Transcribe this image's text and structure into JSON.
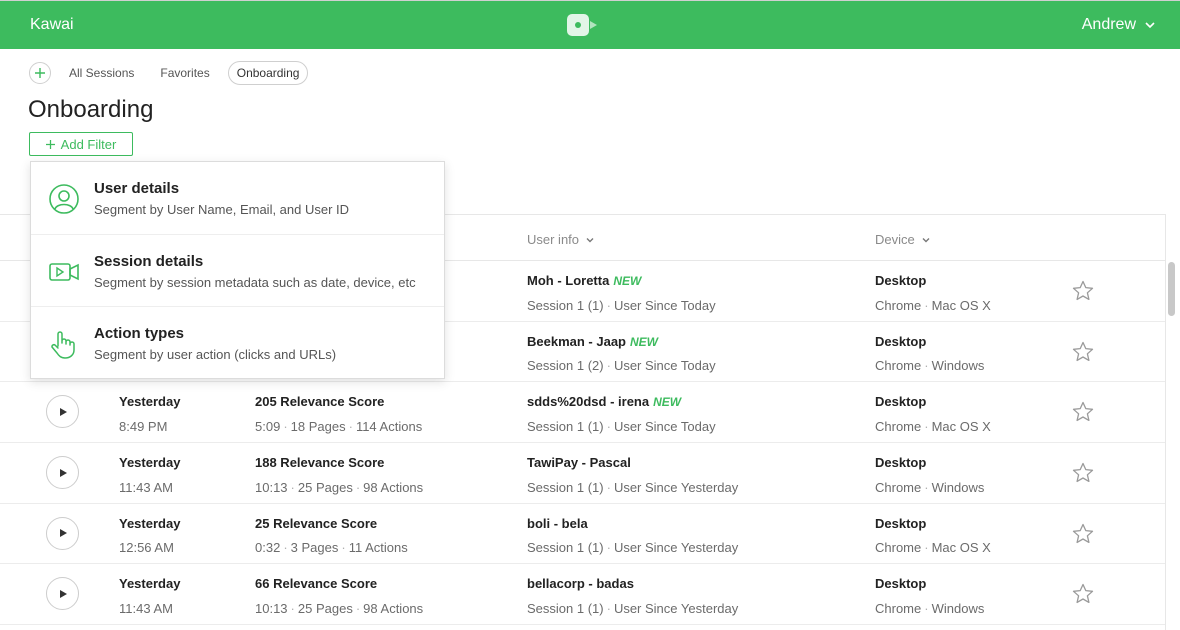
{
  "app": {
    "brand": "Kawai",
    "user": "Andrew"
  },
  "nav": {
    "tabs": [
      "All Sessions",
      "Favorites",
      "Onboarding"
    ],
    "active": "Onboarding"
  },
  "page": {
    "title": "Onboarding",
    "add_filter_label": "Add Filter"
  },
  "table": {
    "columns": {
      "user_info": "User info",
      "device": "Device"
    },
    "rows": [
      {
        "time": "",
        "time2": "",
        "score": "",
        "stats": "",
        "user": "Moh - Loretta",
        "is_new": "NEW",
        "session": "Session 1 (1)",
        "since": "User Since Today",
        "device": "Desktop",
        "browser": "Chrome",
        "os": "Mac OS X"
      },
      {
        "time": "",
        "time2": "",
        "score": "",
        "stats": "",
        "user": "Beekman - Jaap",
        "is_new": "NEW",
        "session": "Session 1 (2)",
        "since": "User Since Today",
        "device": "Desktop",
        "browser": "Chrome",
        "os": "Windows"
      },
      {
        "time": "Yesterday",
        "time2": "8:49 PM",
        "score": "205 Relevance Score",
        "dur": "5:09",
        "pages": "18 Pages",
        "actions": "114 Actions",
        "user": "sdds%20dsd - irena",
        "is_new": "NEW",
        "session": "Session 1 (1)",
        "since": "User Since Today",
        "device": "Desktop",
        "browser": "Chrome",
        "os": "Mac OS X"
      },
      {
        "time": "Yesterday",
        "time2": "11:43 AM",
        "score": "188 Relevance Score",
        "dur": "10:13",
        "pages": "25 Pages",
        "actions": "98 Actions",
        "user": "TawiPay - Pascal",
        "is_new": "",
        "session": "Session 1 (1)",
        "since": "User Since Yesterday",
        "device": "Desktop",
        "browser": "Chrome",
        "os": "Windows"
      },
      {
        "time": "Yesterday",
        "time2": "12:56 AM",
        "score": "25 Relevance Score",
        "dur": "0:32",
        "pages": "3 Pages",
        "actions": "11 Actions",
        "user": "boli - bela",
        "is_new": "",
        "session": "Session 1 (1)",
        "since": "User Since Yesterday",
        "device": "Desktop",
        "browser": "Chrome",
        "os": "Mac OS X"
      },
      {
        "time": "Yesterday",
        "time2": "11:43 AM",
        "score": "66 Relevance Score",
        "dur": "10:13",
        "pages": "25 Pages",
        "actions": "98 Actions",
        "user": "bellacorp - badas",
        "is_new": "",
        "session": "Session 1 (1)",
        "since": "User Since Yesterday",
        "device": "Desktop",
        "browser": "Chrome",
        "os": "Windows"
      }
    ]
  },
  "filter_menu": {
    "items": [
      {
        "title": "User details",
        "subtitle": "Segment by User Name, Email, and User ID",
        "icon": "user-circle-icon"
      },
      {
        "title": "Session details",
        "subtitle": "Segment by session metadata such as date, device, etc",
        "icon": "video-camera-icon"
      },
      {
        "title": "Action types",
        "subtitle": "Segment by user action (clicks and URLs)",
        "icon": "hand-pointer-icon"
      }
    ]
  },
  "colors": {
    "brand": "#3dbb5e",
    "new_badge": "#3dbb5e"
  }
}
